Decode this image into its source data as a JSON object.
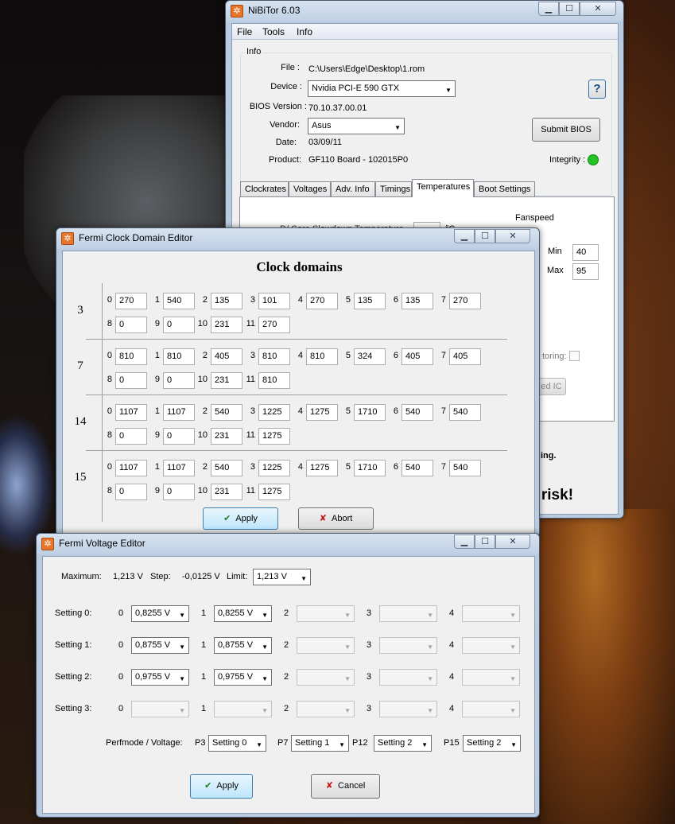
{
  "nibitor": {
    "title": "NiBiTor 6.03",
    "menu": [
      "File",
      "Tools",
      "Info"
    ],
    "info_group": "Info",
    "file_label": "File :",
    "file_value": "C:\\Users\\Edge\\Desktop\\1.rom",
    "device_label": "Device :",
    "device_value": "Nvidia PCI-E 590 GTX",
    "bios_label": "BIOS Version :",
    "bios_value": "70.10.37.00.01",
    "vendor_label": "Vendor:",
    "vendor_value": "Asus",
    "date_label": "Date:",
    "date_value": "03/09/11",
    "product_label": "Product:",
    "product_value": "GF110 Board - 102015P0",
    "submit_button": "Submit BIOS",
    "help_button": "?",
    "integrity_label": "Integrity :",
    "integrity_color": "#22c322",
    "tabs": [
      "Clockrates",
      "Voltages",
      "Adv. Info",
      "Timings",
      "Temperatures",
      "Boot Settings"
    ],
    "active_tab": "Temperatures",
    "fanspeed_label": "Fanspeed",
    "min_label": "Min",
    "min_value": "40",
    "max_label": "Max",
    "max_value": "95",
    "partial_monitoring": "toring:",
    "partial_ic_button": "ed IC",
    "partial_warning": "ing.",
    "partial_risk": "n risk!",
    "partial_temp_text": "D/ Core Slowdown Temperature",
    "partial_temp_unit": "°C"
  },
  "clock_editor": {
    "title": "Fermi Clock Domain Editor",
    "heading": "Clock domains",
    "rows": [
      {
        "label": "3",
        "line1": [
          [
            "0",
            "270"
          ],
          [
            "1",
            "540"
          ],
          [
            "2",
            "135"
          ],
          [
            "3",
            "101"
          ],
          [
            "4",
            "270"
          ],
          [
            "5",
            "135"
          ],
          [
            "6",
            "135"
          ],
          [
            "7",
            "270"
          ]
        ],
        "line2": [
          [
            "8",
            "0"
          ],
          [
            "9",
            "0"
          ],
          [
            "10",
            "231"
          ],
          [
            "11",
            "270"
          ]
        ]
      },
      {
        "label": "7",
        "line1": [
          [
            "0",
            "810"
          ],
          [
            "1",
            "810"
          ],
          [
            "2",
            "405"
          ],
          [
            "3",
            "810"
          ],
          [
            "4",
            "810"
          ],
          [
            "5",
            "324"
          ],
          [
            "6",
            "405"
          ],
          [
            "7",
            "405"
          ]
        ],
        "line2": [
          [
            "8",
            "0"
          ],
          [
            "9",
            "0"
          ],
          [
            "10",
            "231"
          ],
          [
            "11",
            "810"
          ]
        ]
      },
      {
        "label": "14",
        "line1": [
          [
            "0",
            "1107"
          ],
          [
            "1",
            "1107"
          ],
          [
            "2",
            "540"
          ],
          [
            "3",
            "1225"
          ],
          [
            "4",
            "1275"
          ],
          [
            "5",
            "1710"
          ],
          [
            "6",
            "540"
          ],
          [
            "7",
            "540"
          ]
        ],
        "line2": [
          [
            "8",
            "0"
          ],
          [
            "9",
            "0"
          ],
          [
            "10",
            "231"
          ],
          [
            "11",
            "1275"
          ]
        ]
      },
      {
        "label": "15",
        "line1": [
          [
            "0",
            "1107"
          ],
          [
            "1",
            "1107"
          ],
          [
            "2",
            "540"
          ],
          [
            "3",
            "1225"
          ],
          [
            "4",
            "1275"
          ],
          [
            "5",
            "1710"
          ],
          [
            "6",
            "540"
          ],
          [
            "7",
            "540"
          ]
        ],
        "line2": [
          [
            "8",
            "0"
          ],
          [
            "9",
            "0"
          ],
          [
            "10",
            "231"
          ],
          [
            "11",
            "1275"
          ]
        ]
      }
    ],
    "apply_button": "Apply",
    "abort_button": "Abort"
  },
  "voltage_editor": {
    "title": "Fermi Voltage Editor",
    "maximum_label": "Maximum:",
    "maximum_value": "1,213 V",
    "step_label": "Step:",
    "step_value": "-0,0125 V",
    "limit_label": "Limit:",
    "limit_value": "1,213 V",
    "settings": [
      {
        "label": "Setting 0:",
        "values": [
          "0,8255 V",
          "0,8255 V",
          "",
          "",
          ""
        ]
      },
      {
        "label": "Setting 1:",
        "values": [
          "0,8755 V",
          "0,8755 V",
          "",
          "",
          ""
        ]
      },
      {
        "label": "Setting 2:",
        "values": [
          "0,9755 V",
          "0,9755 V",
          "",
          "",
          ""
        ]
      },
      {
        "label": "Setting 3:",
        "values": [
          "",
          "",
          "",
          "",
          ""
        ]
      }
    ],
    "column_labels": [
      "0",
      "1",
      "2",
      "3",
      "4"
    ],
    "perfmode_label": "Perfmode / Voltage:",
    "perfmodes": [
      {
        "label": "P3",
        "value": "Setting 0"
      },
      {
        "label": "P7",
        "value": "Setting 1"
      },
      {
        "label": "P12",
        "value": "Setting 2"
      },
      {
        "label": "P15",
        "value": "Setting 2"
      }
    ],
    "apply_button": "Apply",
    "cancel_button": "Cancel"
  }
}
